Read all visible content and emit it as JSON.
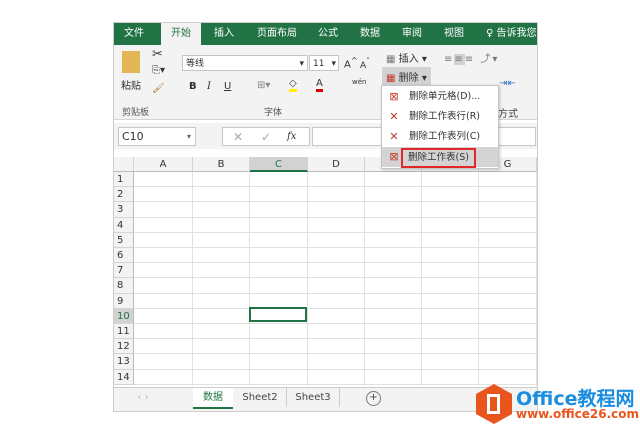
{
  "ribbon": {
    "tabs": [
      "文件",
      "开始",
      "插入",
      "页面布局",
      "公式",
      "数据",
      "审阅",
      "视图"
    ],
    "tell_me": "告诉我您",
    "paste": "粘贴",
    "clipboard": "剪贴板",
    "font_name": "等线",
    "font_size": "11",
    "bold": "B",
    "italic": "I",
    "underline": "U",
    "font_group": "字体",
    "insert": "插入",
    "delete": "删除",
    "align_group": "方式",
    "phonetic": "wén"
  },
  "formula_bar": {
    "name_box": "C10",
    "fx": "fx",
    "value": ""
  },
  "grid": {
    "columns": [
      "A",
      "B",
      "C",
      "D",
      "E",
      "F",
      "G"
    ],
    "rows": [
      "1",
      "2",
      "3",
      "4",
      "5",
      "6",
      "7",
      "8",
      "9",
      "10",
      "11",
      "12",
      "13",
      "14"
    ],
    "selected_cell": "C10"
  },
  "menu": {
    "items": [
      "删除单元格(D)...",
      "删除工作表行(R)",
      "删除工作表列(C)",
      "删除工作表(S)"
    ],
    "highlighted": 3
  },
  "sheets": {
    "tabs": [
      "数据",
      "Sheet2",
      "Sheet3"
    ],
    "active": 0,
    "add": "+"
  },
  "watermark": {
    "title": "Office教程网",
    "url": "www.office26.com"
  },
  "colors": {
    "accent": "#217346",
    "logo": "#e8561d",
    "watermark_blue": "#1b8de0",
    "highlight_border": "#e0282b"
  }
}
